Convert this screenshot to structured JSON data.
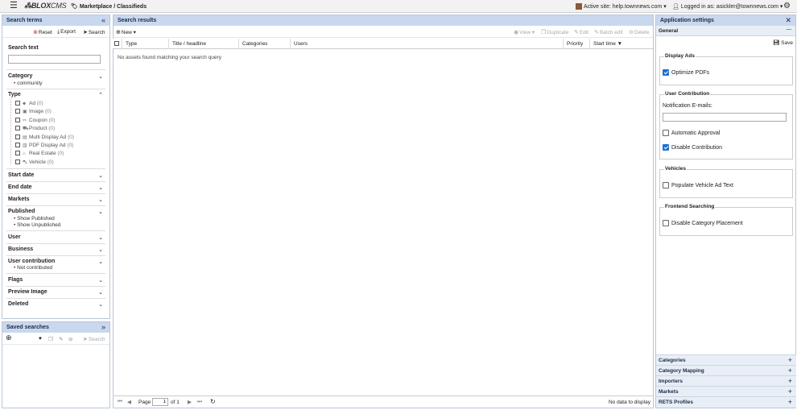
{
  "topbar": {
    "logo_bold": "BLOX",
    "logo_rest": "CMS",
    "breadcrumb": "Marketplace / Classifieds",
    "active_site": "Active site: help.townnews.com ▾",
    "logged_in": "Logged in as: asickler@townnews.com ▾"
  },
  "search_terms": {
    "title": "Search terms",
    "reset": "Reset",
    "export": "Export",
    "search": "Search",
    "search_text_label": "Search text",
    "search_text_value": "",
    "category_label": "Category",
    "category_value": "community",
    "type_label": "Type",
    "types": [
      {
        "label": "Ad",
        "count": "(0)",
        "icon": "tag-icon"
      },
      {
        "label": "Image",
        "count": "(0)",
        "icon": "image-icon"
      },
      {
        "label": "Coupon",
        "count": "(0)",
        "icon": "scissors-icon"
      },
      {
        "label": "Product",
        "count": "(0)",
        "icon": "cart-icon"
      },
      {
        "label": "Multi Display Ad",
        "count": "(0)",
        "icon": "multi-display-icon"
      },
      {
        "label": "PDF Display Ad",
        "count": "(0)",
        "icon": "pdf-icon"
      },
      {
        "label": "Real Estate",
        "count": "(0)",
        "icon": "house-icon"
      },
      {
        "label": "Vehicle",
        "count": "(0)",
        "icon": "car-icon"
      }
    ],
    "start_date": "Start date",
    "end_date": "End date",
    "markets": "Markets",
    "published": "Published",
    "published_values": [
      "Show Published",
      "Show Unpublished"
    ],
    "user": "User",
    "business": "Business",
    "user_contribution": "User contribution",
    "user_contribution_value": "Not contributed",
    "flags": "Flags",
    "preview_image": "Preview Image",
    "deleted": "Deleted"
  },
  "saved_searches": {
    "title": "Saved searches",
    "search": "Search"
  },
  "results": {
    "title": "Search results",
    "new": "New ▾",
    "view": "View ▾",
    "duplicate": "Duplicate",
    "edit": "Edit",
    "batch_edit": "Batch edit",
    "delete": "Delete",
    "columns": [
      "Type",
      "Title / headline",
      "Categories",
      "Users",
      "Priority",
      "Start time"
    ],
    "empty": "No assets found matching your search query",
    "pager_page": "Page",
    "pager_value": "1",
    "pager_of": "of 1",
    "no_data": "No data to display"
  },
  "settings": {
    "title": "Application settings",
    "section": "General",
    "save": "Save",
    "display_ads": "Display Ads",
    "optimize_pdfs": "Optimize PDFs",
    "user_contribution": "User Contribution",
    "notification_emails": "Notification E-mails:",
    "notification_value": "",
    "automatic_approval": "Automatic Approval",
    "disable_contribution": "Disable Contribution",
    "vehicles": "Vehicles",
    "populate_vehicle": "Populate Vehicle Ad Text",
    "frontend_searching": "Frontend Searching",
    "disable_category_placement": "Disable Category Placement",
    "accordions": [
      "Categories",
      "Category Mapping",
      "Importers",
      "Markets",
      "RETS Profiles"
    ],
    "checked": {
      "optimize_pdfs": true,
      "automatic_approval": false,
      "disable_contribution": true,
      "populate_vehicle": false,
      "disable_category_placement": false
    }
  }
}
